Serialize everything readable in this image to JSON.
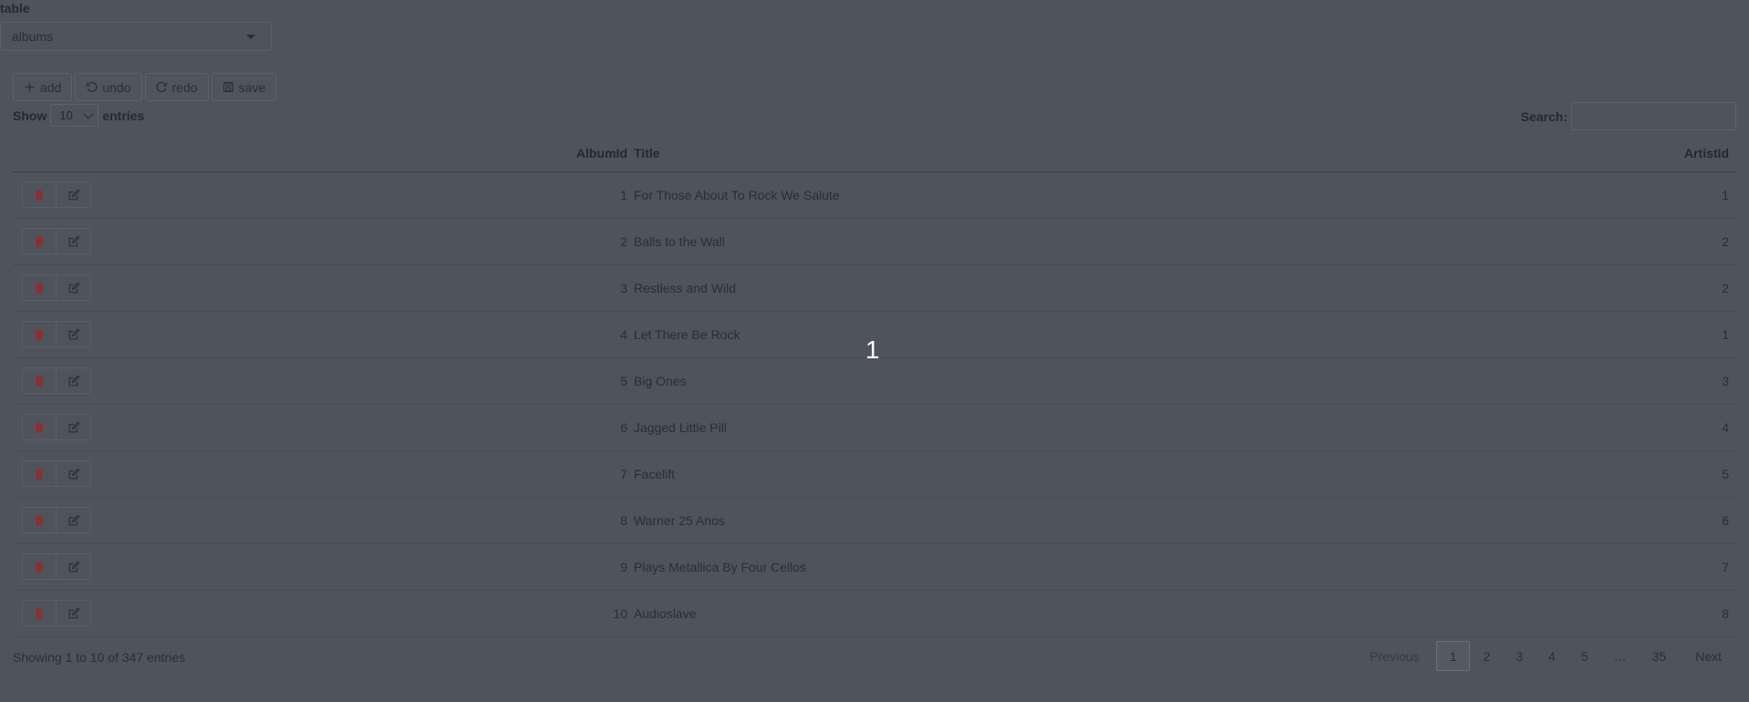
{
  "table_selector": {
    "label": "table",
    "value": "albums"
  },
  "toolbar": {
    "add": "add",
    "undo": "undo",
    "redo": "redo",
    "save": "save"
  },
  "length_menu": {
    "show": "Show",
    "value": "10",
    "entries": "entries"
  },
  "search": {
    "label": "Search:",
    "value": ""
  },
  "columns": {
    "album_id": "AlbumId",
    "title": "Title",
    "artist_id": "ArtistId"
  },
  "rows": [
    {
      "album_id": "1",
      "title": "For Those About To Rock We Salute",
      "artist_id": "1"
    },
    {
      "album_id": "2",
      "title": "Balls to the Wall",
      "artist_id": "2"
    },
    {
      "album_id": "3",
      "title": "Restless and Wild",
      "artist_id": "2"
    },
    {
      "album_id": "4",
      "title": "Let There Be Rock",
      "artist_id": "1"
    },
    {
      "album_id": "5",
      "title": "Big Ones",
      "artist_id": "3"
    },
    {
      "album_id": "6",
      "title": "Jagged Little Pill",
      "artist_id": "4"
    },
    {
      "album_id": "7",
      "title": "Facelift",
      "artist_id": "5"
    },
    {
      "album_id": "8",
      "title": "Warner 25 Anos",
      "artist_id": "6"
    },
    {
      "album_id": "9",
      "title": "Plays Metallica By Four Cellos",
      "artist_id": "7"
    },
    {
      "album_id": "10",
      "title": "Audioslave",
      "artist_id": "8"
    }
  ],
  "info": "Showing 1 to 10 of 347 entries",
  "pagination": {
    "previous": "Previous",
    "pages": [
      "1",
      "2",
      "3",
      "4",
      "5",
      "…",
      "35"
    ],
    "next": "Next",
    "current": "1"
  },
  "overlay_number": "1",
  "colors": {
    "delete_icon": "#8b2f33",
    "overlay_bg": "#4f535c"
  },
  "icons": {
    "delete": "trash-icon",
    "edit": "edit-icon",
    "add": "plus-icon",
    "undo": "undo-icon",
    "redo": "redo-icon",
    "save": "save-icon"
  }
}
